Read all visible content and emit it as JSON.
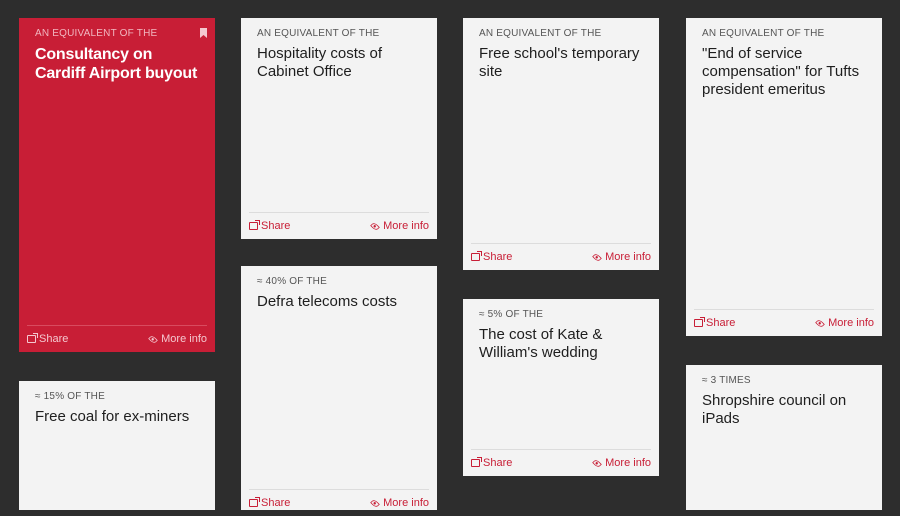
{
  "actions": {
    "share_label": "Share",
    "more_label": "More info"
  },
  "cards": [
    {
      "eyebrow": "AN EQUIVALENT OF THE",
      "title": "Consultancy on Cardiff Airport buyout"
    },
    {
      "eyebrow": "≈ 15% OF THE",
      "title": "Free coal for ex-miners"
    },
    {
      "eyebrow": "AN EQUIVALENT OF THE",
      "title": "Hospitality costs of Cabinet Office"
    },
    {
      "eyebrow": "≈ 40% OF THE",
      "title": "Defra telecoms costs"
    },
    {
      "eyebrow": "AN EQUIVALENT OF THE",
      "title": "Free school's temporary site"
    },
    {
      "eyebrow": "≈ 5% OF THE",
      "title": "The cost of Kate & William's wedding"
    },
    {
      "eyebrow": "AN EQUIVALENT OF THE",
      "title": "\"End of service compensation\" for Tufts president emeritus"
    },
    {
      "eyebrow": "≈ 3 TIMES",
      "title": "Shropshire council on iPads"
    }
  ],
  "colors": {
    "background": "#2d2d2d",
    "card": "#f3f3f3",
    "accent": "#c81e36"
  }
}
